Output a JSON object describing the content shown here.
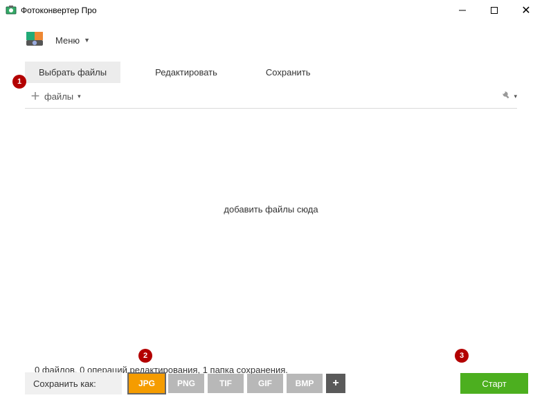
{
  "window": {
    "title": "Фотоконвертер Про"
  },
  "menu": {
    "label": "Меню"
  },
  "tabs": {
    "select": "Выбрать файлы",
    "edit": "Редактировать",
    "save": "Сохранить"
  },
  "toolbar": {
    "add_files": "файлы"
  },
  "drop": {
    "hint": "добавить файлы сюда"
  },
  "status": {
    "text": "0 файлов, 0 операций редактирования, 1 папка сохранения."
  },
  "save_as": {
    "label": "Сохранить как:",
    "formats": {
      "jpg": "JPG",
      "png": "PNG",
      "tif": "TIF",
      "gif": "GIF",
      "bmp": "BMP"
    }
  },
  "start": {
    "label": "Старт"
  },
  "annotations": {
    "a1": "1",
    "a2": "2",
    "a3": "3"
  }
}
